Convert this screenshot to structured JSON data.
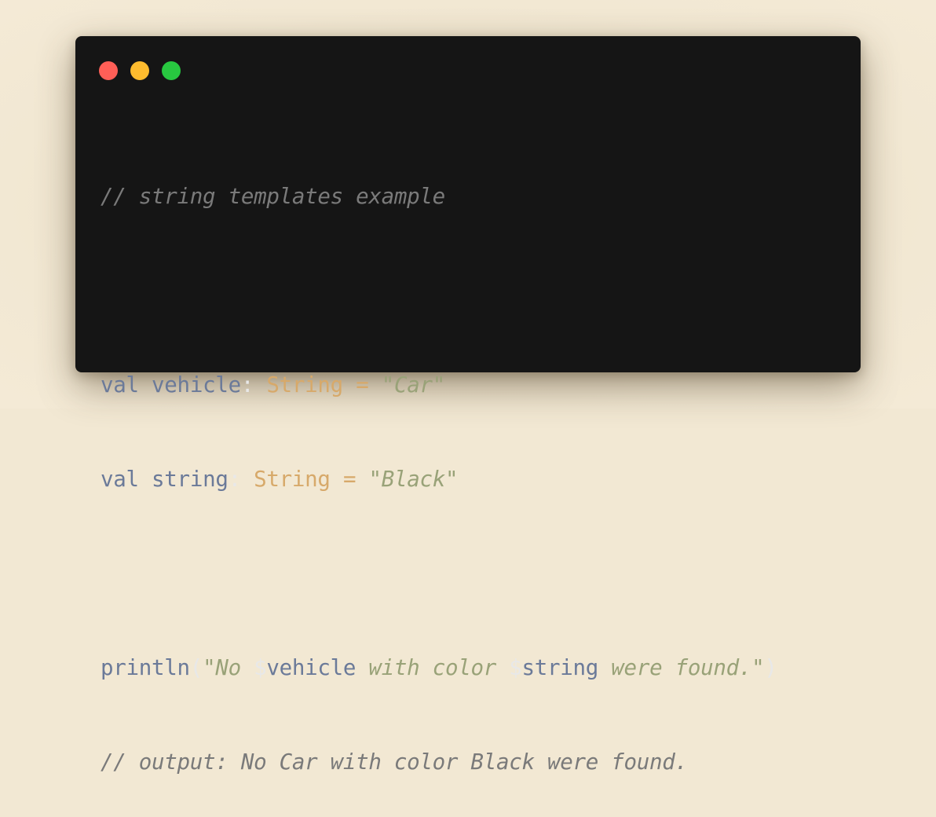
{
  "colors": {
    "background": "#f2e8d3",
    "window": "#151515",
    "close": "#ff5f57",
    "minimize": "#febc2e",
    "maximize": "#28c840",
    "comment": "#7a7a7a",
    "keyword": "#6b7a99",
    "type": "#d7a96a",
    "string": "#99a278",
    "punctuation": "#e8e8e8"
  },
  "code": {
    "comment_1": "// string templates example",
    "line_1": {
      "keyword": "val",
      "name": "vehicle",
      "colon": ":",
      "type": "String",
      "equals": "=",
      "value": "\"Car\""
    },
    "line_2": {
      "keyword": "val",
      "name": "string",
      "colon": ":",
      "type": "String",
      "equals": "=",
      "value": "\"Black\""
    },
    "line_3": {
      "func": "println",
      "open_paren": "(",
      "str_start": "\"No ",
      "dollar_1": "$",
      "var_1": "vehicle",
      "str_mid": " with color ",
      "dollar_2": "$",
      "var_2": "string",
      "str_end": " were found.\"",
      "close_paren": ")"
    },
    "comment_2": "// output: No Car with color Black were found."
  }
}
